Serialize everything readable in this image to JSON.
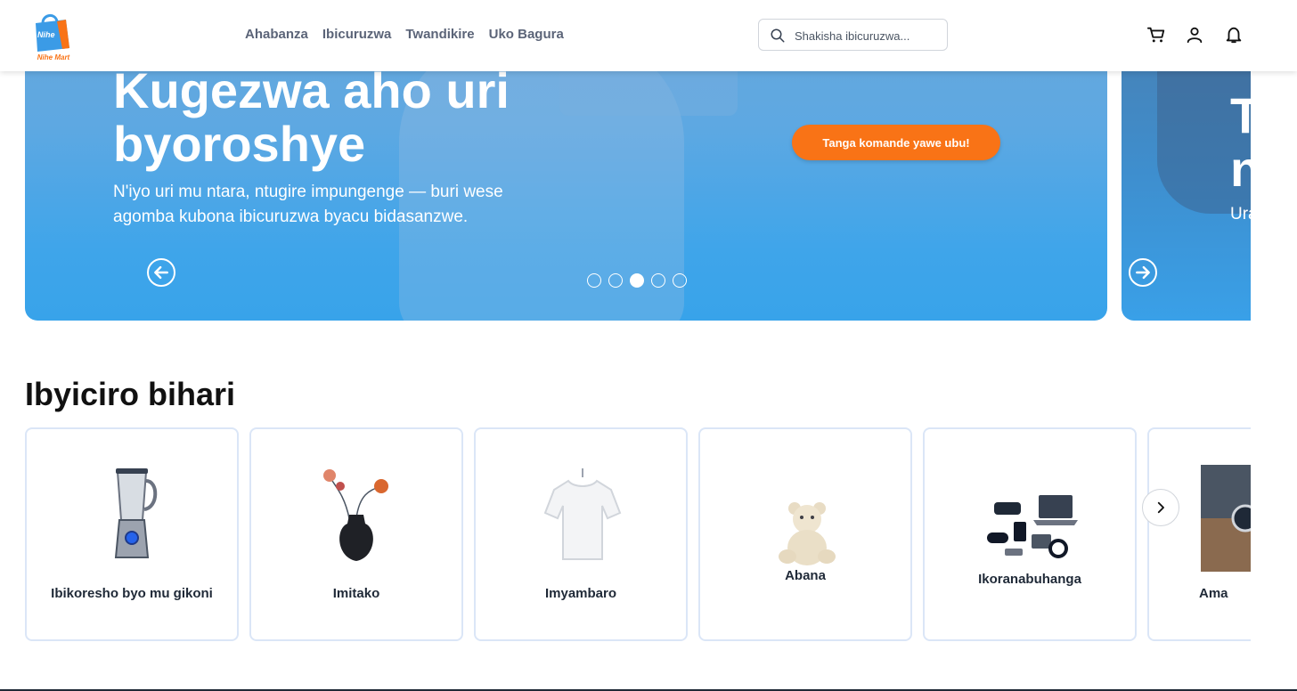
{
  "header": {
    "logo_text": "Nihe Mart",
    "logo_bag_text": "Nihe",
    "nav": [
      "Ahabanza",
      "Ibicuruzwa",
      "Twandikire",
      "Uko Bagura"
    ],
    "search_placeholder": "Shakisha ibicuruzwa...",
    "icons": [
      "cart-icon",
      "user-icon",
      "bell-icon"
    ]
  },
  "hero": {
    "title": "Kugezwa aho uri byoroshye",
    "subtitle": "N'iyo uri mu ntara, ntugire impungenge — buri wese agomba kubona ibicuruzwa byacu bidasanzwe.",
    "cta": "Tanga komande yawe ubu!",
    "next_title": "T\nn",
    "next_sub": "Ura",
    "active_dot": 2,
    "dot_count": 5
  },
  "categories": {
    "title": "Ibyiciro bihari",
    "items": [
      {
        "label": "Ibikoresho byo mu gikoni",
        "icon": "blender-icon"
      },
      {
        "label": "Imitako",
        "icon": "vase-icon"
      },
      {
        "label": "Imyambaro",
        "icon": "tshirt-icon"
      },
      {
        "label": "Abana",
        "icon": "teddy-bear-icon"
      },
      {
        "label": "Ikoranabuhanga",
        "icon": "electronics-icon"
      },
      {
        "label": "Ama",
        "icon": "watch-icon"
      }
    ]
  },
  "colors": {
    "accent": "#f97316",
    "hero_blue": "#3fa5ea",
    "nav_text": "#5b6478",
    "card_border": "#dbe6f7"
  }
}
